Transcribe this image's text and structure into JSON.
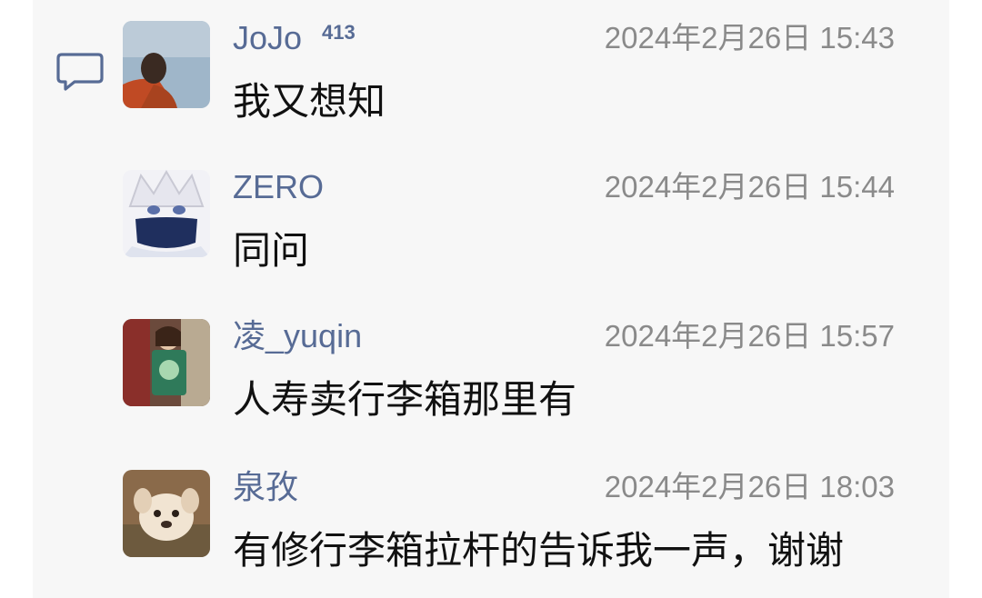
{
  "comments_section": {
    "icon": "comment-icon",
    "messages": [
      {
        "user": "JoJo",
        "badge": "413",
        "time": "2024年2月26日 15:43",
        "text": "我又想知",
        "avatar": "avatar-person-sky"
      },
      {
        "user": "ZERO",
        "badge": "",
        "time": "2024年2月26日 15:44",
        "text": "同问",
        "avatar": "avatar-anime-masked"
      },
      {
        "user": "凌_yuqin",
        "badge": "",
        "time": "2024年2月26日 15:57",
        "text": "人寿卖行李箱那里有",
        "avatar": "avatar-person-bag"
      },
      {
        "user": "泉孜",
        "badge": "",
        "time": "2024年2月26日 18:03",
        "text": "有修行李箱拉杆的告诉我一声，谢谢",
        "avatar": "avatar-puppy"
      }
    ]
  },
  "colors": {
    "name": "#576b95",
    "time": "#8a8a8a",
    "text": "#111111",
    "panel": "#f7f7f7"
  }
}
